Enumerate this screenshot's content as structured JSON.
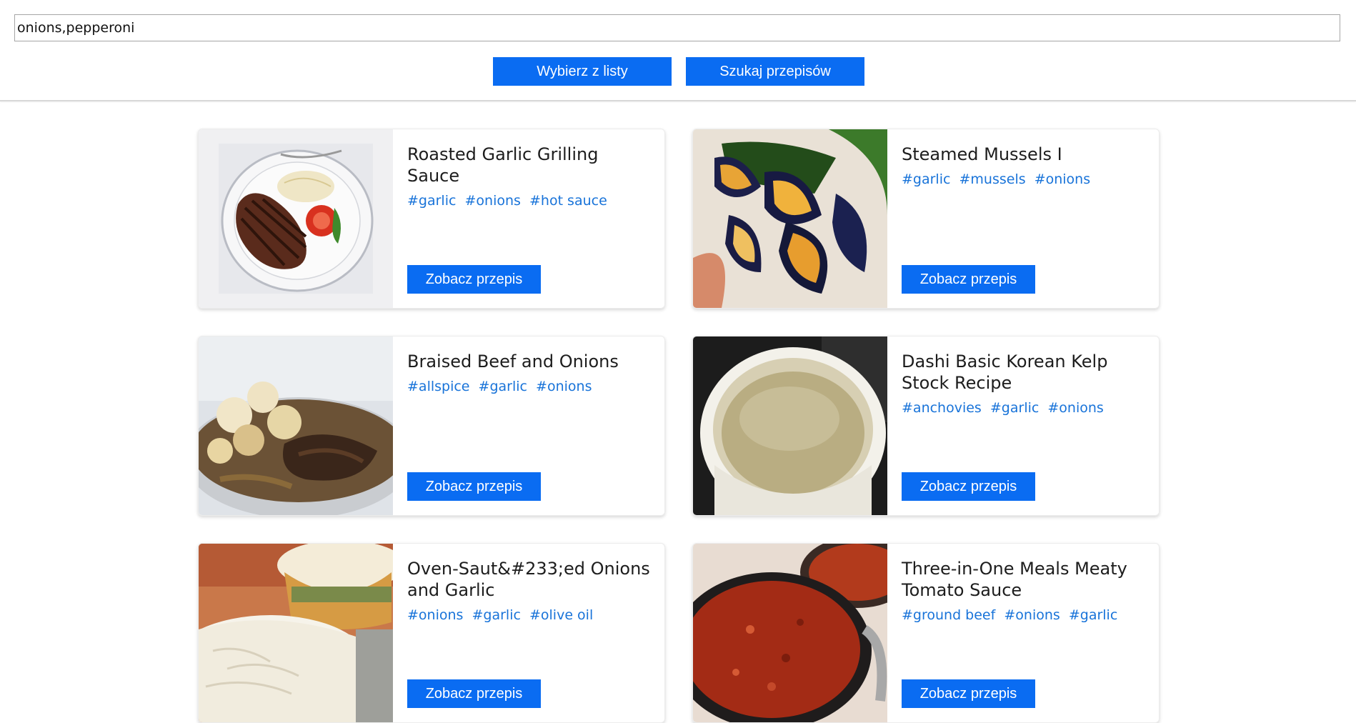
{
  "search": {
    "value": "onions,pepperoni",
    "placeholder": ""
  },
  "buttons": {
    "pick_from_list": "Wybierz z listy",
    "search_recipes": "Szukaj przepisów"
  },
  "colors": {
    "accent": "#0a6cf2",
    "tag": "#1873d9"
  },
  "recipes": [
    {
      "title": "Roasted Garlic Grilling Sauce",
      "tags": [
        "#garlic",
        "#onions",
        "#hot sauce"
      ],
      "button": "Zobacz przepis",
      "image": "steak-plate-image"
    },
    {
      "title": "Steamed Mussels I",
      "tags": [
        "#garlic",
        "#mussels",
        "#onions"
      ],
      "button": "Zobacz przepis",
      "image": "mussels-image"
    },
    {
      "title": "Braised Beef and Onions",
      "tags": [
        "#allspice",
        "#garlic",
        "#onions"
      ],
      "button": "Zobacz przepis",
      "image": "braised-beef-image"
    },
    {
      "title": "Dashi Basic Korean Kelp Stock Recipe",
      "tags": [
        "#anchovies",
        "#garlic",
        "#onions"
      ],
      "button": "Zobacz przepis",
      "image": "broth-bowl-image"
    },
    {
      "title": "Oven-Saut&#233;ed Onions and Garlic",
      "tags": [
        "#onions",
        "#garlic",
        "#olive oil"
      ],
      "button": "Zobacz przepis",
      "image": "onions-bowl-image"
    },
    {
      "title": "Three-in-One Meals Meaty Tomato Sauce",
      "tags": [
        "#ground beef",
        "#onions",
        "#garlic"
      ],
      "button": "Zobacz przepis",
      "image": "tomato-sauce-image"
    }
  ]
}
